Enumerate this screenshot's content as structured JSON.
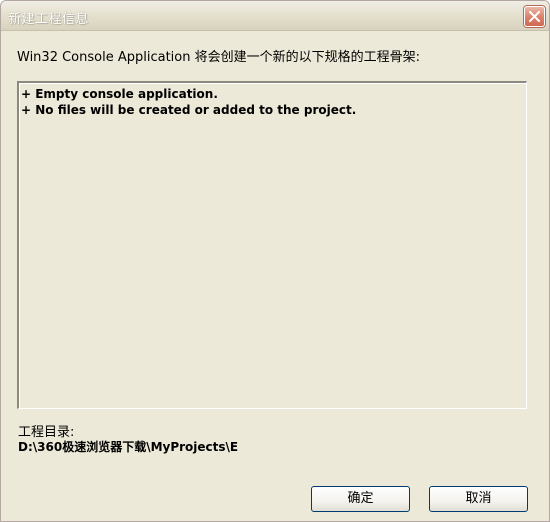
{
  "window": {
    "title": "新建工程信息"
  },
  "description": "Win32 Console Application 将会创建一个新的以下规格的工程骨架:",
  "spec_lines": [
    "+ Empty console application.",
    "+ No files will be created or added to the project."
  ],
  "project_dir": {
    "label": "工程目录:",
    "path": "D:\\360极速浏览器下载\\MyProjects\\E"
  },
  "buttons": {
    "ok": "确定",
    "cancel": "取消"
  },
  "colors": {
    "dialog_bg": "#ece9d8",
    "close_button": "#d9816a",
    "button_border": "#003c74"
  },
  "icons": {
    "close": "close-icon"
  }
}
